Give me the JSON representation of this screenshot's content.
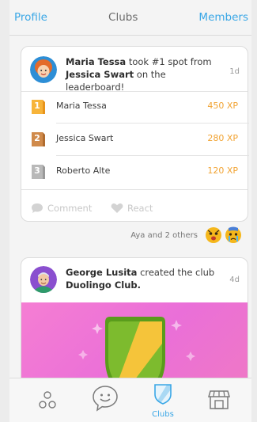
{
  "topbar": {
    "profile_label": "Profile",
    "title": "Clubs",
    "members_label": "Members"
  },
  "feed": {
    "leaderboard_post": {
      "actor": "Maria Tessa",
      "action": "took #1 spot from",
      "target": "Jessica Swart",
      "suffix": "on the leaderboard!",
      "time": "1d",
      "rows": [
        {
          "rank": "1",
          "name": "Maria Tessa",
          "xp": "450 XP",
          "medal_color": "#f7b43a",
          "medal_shadow": "#e8941c"
        },
        {
          "rank": "2",
          "name": "Jessica Swart",
          "xp": "280 XP",
          "medal_color": "#d08a4a",
          "medal_shadow": "#b06c30"
        },
        {
          "rank": "3",
          "name": "Roberto Alte",
          "xp": "120 XP",
          "medal_color": "#b9b9b9",
          "medal_shadow": "#9a9a9a"
        }
      ],
      "comment_label": "Comment",
      "react_label": "React"
    },
    "reactors_text": "Aya and 2 others",
    "club_post": {
      "actor": "George Lusita",
      "action": "created the club",
      "club_name": "Duolingo Club.",
      "time": "4d"
    }
  },
  "bottom_nav": {
    "clubs_label": "Clubs"
  },
  "colors": {
    "accent": "#3aa7e6",
    "xp": "#f1a332",
    "banner_pink": "#f07ad0",
    "shield_green": "#7dbb2e",
    "shield_yellow": "#f5c43a"
  }
}
